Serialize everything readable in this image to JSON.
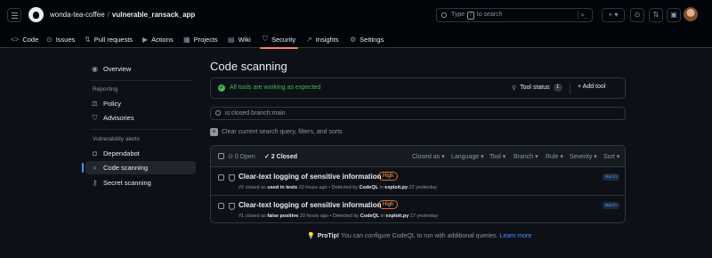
{
  "header": {
    "owner": "wonda-tea-coffee",
    "separator": "/",
    "repo": "vulnerable_ransack_app",
    "search": {
      "prefix": "Type",
      "key": "/",
      "suffix": "to search",
      "cmd": ">_"
    },
    "buttons": {
      "plus": "+ ▾",
      "issues": "⊙",
      "pulls": "⇅",
      "inbox": "▣"
    }
  },
  "tabs": [
    {
      "icon": "<>",
      "label": "Code"
    },
    {
      "icon": "⊙",
      "label": "Issues"
    },
    {
      "icon": "⇅",
      "label": "Pull requests"
    },
    {
      "icon": "▶",
      "label": "Actions"
    },
    {
      "icon": "▦",
      "label": "Projects"
    },
    {
      "icon": "▤",
      "label": "Wiki"
    },
    {
      "icon": "⛉",
      "label": "Security"
    },
    {
      "icon": "↗",
      "label": "Insights"
    },
    {
      "icon": "⚙",
      "label": "Settings"
    }
  ],
  "sidebar": {
    "overview": "Overview",
    "reporting_heading": "Reporting",
    "policy": "Policy",
    "advisories": "Advisories",
    "vuln_heading": "Vulnerability alerts",
    "dependabot": "Dependabot",
    "code_scanning": "Code scanning",
    "secret_scanning": "Secret scanning"
  },
  "main": {
    "title": "Code scanning",
    "status": {
      "message": "All tools are working as expected",
      "tool_status_label": "Tool status",
      "tool_count": "1",
      "add_tool_label": "+ Add tool"
    },
    "filter_value": "is:closed branch:main",
    "clear_label": "Clear current search query, filters, and sorts",
    "results": {
      "open_label": "0 Open",
      "closed_label": "✓ 2 Closed",
      "filters": [
        "Closed as ▾",
        "Language ▾",
        "Tool ▾",
        "Branch ▾",
        "Rule ▾",
        "Severity ▾",
        "Sort ▾"
      ],
      "rows": [
        {
          "title": "Clear-text logging of sensitive information",
          "severity": "High",
          "meta_prefix": "#2 closed as",
          "reason": "used in tests",
          "meta_mid": "20 hours ago • Detected by",
          "tool": "CodeQL",
          "in_word": "in",
          "location": "exploit.py",
          "line_info": ":22 yesterday",
          "branch": "main"
        },
        {
          "title": "Clear-text logging of sensitive information",
          "severity": "High",
          "meta_prefix": "#1 closed as",
          "reason": "false positive",
          "meta_mid": "20 hours ago • Detected by",
          "tool": "CodeQL",
          "in_word": "in",
          "location": "exploit.py",
          "line_info": ":17 yesterday",
          "branch": "main"
        }
      ]
    },
    "protip": {
      "label": "ProTip!",
      "text": "You can configure CodeQL to run with additional queries.",
      "link": "Learn more"
    }
  },
  "colors": {
    "background": "#0d1117",
    "success": "#3fb950",
    "link": "#4493f8",
    "severity_high": "#db6d28",
    "active_tab_underline": "#f78166"
  }
}
